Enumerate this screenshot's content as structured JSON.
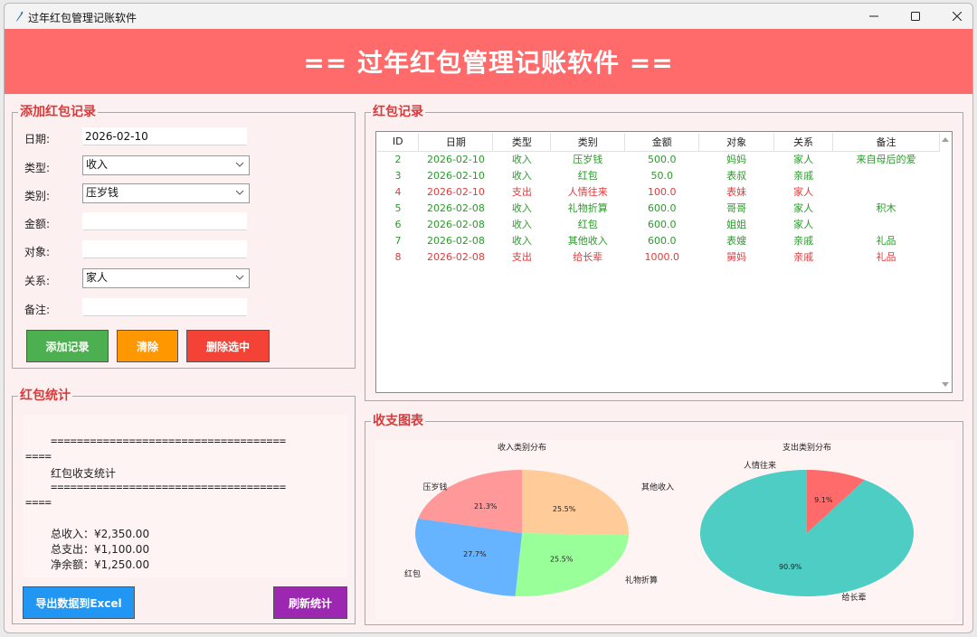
{
  "window": {
    "title": "过年红包管理记账软件"
  },
  "banner": {
    "title": "== 过年红包管理记账软件 =="
  },
  "add_form": {
    "legend": "添加红包记录",
    "date_label": "日期:",
    "date_value": "2026-02-10",
    "type_label": "类型:",
    "type_value": "收入",
    "category_label": "类别:",
    "category_value": "压岁钱",
    "amount_label": "金额:",
    "amount_value": "",
    "target_label": "对象:",
    "target_value": "",
    "relation_label": "关系:",
    "relation_value": "家人",
    "note_label": "备注:",
    "note_value": "",
    "add_btn": "添加记录",
    "clear_btn": "清除",
    "delete_btn": "删除选中",
    "colors": {
      "add": "#4caf50",
      "clear": "#ff9800",
      "delete": "#f44336"
    }
  },
  "records": {
    "legend": "红包记录",
    "columns": [
      "ID",
      "日期",
      "类型",
      "类别",
      "金额",
      "对象",
      "关系",
      "备注"
    ],
    "rows": [
      [
        "2",
        "2026-02-10",
        "收入",
        "压岁钱",
        "500.0",
        "妈妈",
        "家人",
        "来自母后的爱"
      ],
      [
        "3",
        "2026-02-10",
        "收入",
        "红包",
        "50.0",
        "表叔",
        "亲戚",
        ""
      ],
      [
        "4",
        "2026-02-10",
        "支出",
        "人情往来",
        "100.0",
        "表妹",
        "家人",
        ""
      ],
      [
        "5",
        "2026-02-08",
        "收入",
        "礼物折算",
        "600.0",
        "哥哥",
        "家人",
        "积木"
      ],
      [
        "6",
        "2026-02-08",
        "收入",
        "红包",
        "600.0",
        "姐姐",
        "家人",
        ""
      ],
      [
        "7",
        "2026-02-08",
        "收入",
        "其他收入",
        "600.0",
        "表嫂",
        "亲戚",
        "礼品"
      ],
      [
        "8",
        "2026-02-08",
        "支出",
        "给长辈",
        "1000.0",
        "舅妈",
        "亲戚",
        "礼品"
      ]
    ],
    "colors": {
      "income": "#2a9a2a",
      "expense": "#e23b3b"
    }
  },
  "stats": {
    "legend": "红包统计",
    "sep1": "====================================",
    "sep1b": "====",
    "heading": "红包收支统计",
    "sep2": "====================================",
    "sep2b": "====",
    "income": "总收入：¥2,350.00",
    "expense": "总支出：¥1,100.00",
    "net": "净余额：¥1,250.00",
    "export_btn": "导出数据到Excel",
    "refresh_btn": "刷新统计",
    "colors": {
      "export": "#2196f3",
      "refresh": "#9c27b0"
    }
  },
  "charts_group": {
    "legend": "收支图表"
  },
  "chart_data": [
    {
      "type": "pie",
      "title": "收入类别分布",
      "labels": [
        "其他收入",
        "礼物折算",
        "红包",
        "压岁钱"
      ],
      "values": [
        25.5,
        25.5,
        27.7,
        21.3
      ],
      "value_labels": [
        "25.5%",
        "25.5%",
        "27.7%",
        "21.3%"
      ],
      "colors": [
        "#ffcc99",
        "#99ff99",
        "#66b3ff",
        "#ff9999"
      ]
    },
    {
      "type": "pie",
      "title": "支出类别分布",
      "labels": [
        "人情往来",
        "给长辈"
      ],
      "values": [
        9.1,
        90.9
      ],
      "value_labels": [
        "9.1%",
        "90.9%"
      ],
      "colors": [
        "#ff6b6b",
        "#4ecdc4"
      ]
    }
  ]
}
